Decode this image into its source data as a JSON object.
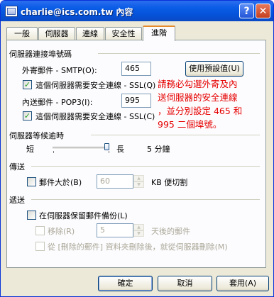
{
  "window": {
    "title": "charlie@ics.com.tw 內容",
    "help_button": "?",
    "close_button": "✕"
  },
  "tabs": [
    "一般",
    "伺服器",
    "連線",
    "安全性",
    "進階"
  ],
  "sections": {
    "ports": {
      "heading": "伺服器連接埠號碼",
      "smtp_label": "外寄郵件 - SMTP(O):",
      "smtp_value": "465",
      "default_button": "使用預設值(U)",
      "ssl_smtp_label": "這個伺服器需要安全連線 - SSL(Q)",
      "pop3_label": "內送郵件 - POP3(I):",
      "pop3_value": "995",
      "ssl_pop3_label": "這個伺服器需要安全連線 - SSL(C)"
    },
    "timeout": {
      "heading": "伺服器等候逾時",
      "short": "短",
      "long": "長",
      "value": "5 分鐘",
      "level": 0.95
    },
    "sending": {
      "heading": "傳送",
      "break_label": "郵件大於(B)",
      "break_value": "60",
      "unit": "KB 便切割"
    },
    "delivery": {
      "heading": "遞送",
      "leave_copy_label": "在伺服器保留郵件備份(L)",
      "remove_label": "移除(R)",
      "remove_value": "5",
      "remove_after": "天後的郵件",
      "remove_deleted_label": "從 [刪除的郵件] 資料夾刪除後，就從伺服器刪除(M)"
    }
  },
  "annotation": [
    "請務必勾選外寄及內",
    "送伺服器的安全連線",
    "，並分別設定 465 和",
    "995 二個埠號。"
  ],
  "footer": {
    "ok": "確定",
    "cancel": "取消",
    "apply": "套用(A)"
  }
}
